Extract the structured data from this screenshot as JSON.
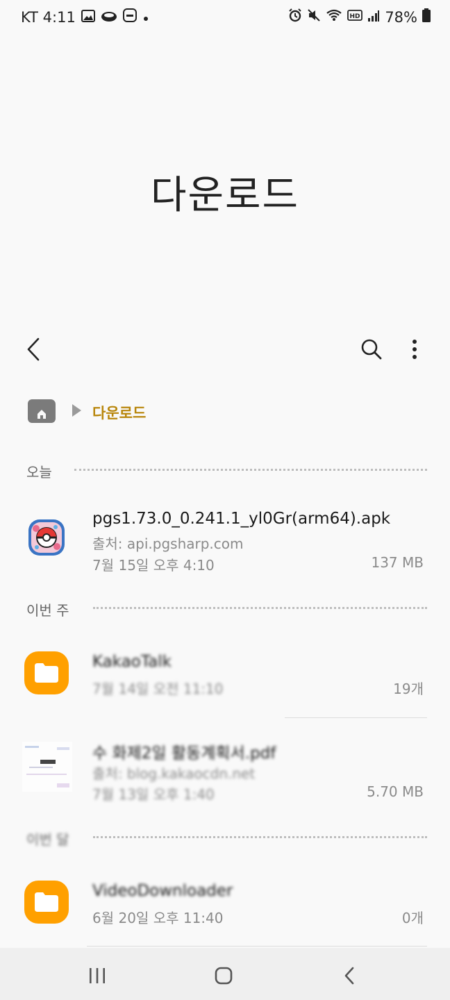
{
  "status_bar": {
    "carrier_time": "KT 4:11",
    "battery": "78%",
    "notification_icons": [
      "gallery-icon",
      "cloud-icon",
      "minus-circle-icon",
      "dot-icon"
    ],
    "system_icons": [
      "alarm-icon",
      "mute-icon",
      "wifi-icon",
      "hd-voice-icon",
      "signal-icon",
      "battery-icon"
    ]
  },
  "header": {
    "title": "다운로드"
  },
  "toolbar": {
    "icons": [
      "back-icon",
      "search-icon",
      "more-options-icon"
    ]
  },
  "breadcrumb": {
    "current": "다운로드"
  },
  "sections": [
    {
      "label": "오늘",
      "items": [
        {
          "name": "pgs1.73.0_0.241.1_yl0Gr(arm64).apk",
          "source": "출처: api.pgsharp.com",
          "date": "7월 15일 오후 4:10",
          "size": "137 MB",
          "icon": "pokeball-app-icon"
        }
      ]
    },
    {
      "label": "이번 주",
      "items": [
        {
          "name": "KakaoTalk",
          "date": "7월 14일 오전 11:10",
          "size": "19개",
          "icon": "folder-icon"
        },
        {
          "name": "수 화제2일 활동계획서.pdf",
          "source": "출처: blog.kakaocdn.net",
          "date": "7월 13일 오후 1:40",
          "size": "5.70 MB",
          "icon": "pdf-thumbnail"
        }
      ]
    },
    {
      "label": "이번 달",
      "items": [
        {
          "name": "VideoDownloader",
          "date": "6월 20일 오후 11:40",
          "size": "0개",
          "icon": "folder-icon"
        }
      ]
    }
  ],
  "nav_bar": {
    "icons": [
      "recent-apps-icon",
      "home-icon",
      "back-icon"
    ]
  },
  "colors": {
    "accent": "#b8860b",
    "folder": "#ffa000",
    "background": "#f9f9f9"
  }
}
